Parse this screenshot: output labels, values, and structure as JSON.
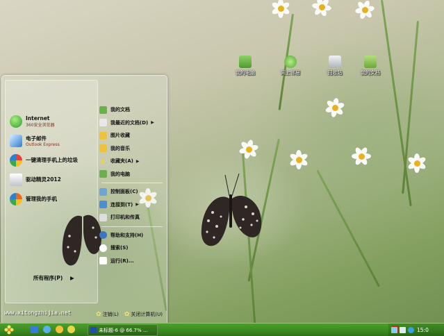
{
  "desktop": {
    "icons": [
      {
        "label": "我的电脑",
        "icon": "computer-icon",
        "color": "#6bb14a"
      },
      {
        "label": "网上邻居",
        "icon": "network-icon",
        "color": "#5cb338"
      },
      {
        "label": "回收站",
        "icon": "recycle-bin-icon",
        "color": "#cfd8dc"
      },
      {
        "label": "我的文档",
        "icon": "documents-folder-icon",
        "color": "#87c24c"
      }
    ],
    "watermark": "www.xitongzhijia.net"
  },
  "start_menu": {
    "pinned": [
      {
        "title": "Internet",
        "subtitle": "360安全浏览器",
        "icon": "browser-360-icon",
        "color": "#3ab54a"
      },
      {
        "title": "电子邮件",
        "subtitle": "Outlook Express",
        "icon": "email-icon",
        "color": "#2f7fd1"
      },
      {
        "title": "一键清理手机上的垃圾",
        "subtitle": "",
        "icon": "phone-clean-icon",
        "color": "#e7423a"
      },
      {
        "title": "驱动精灵2012",
        "subtitle": "",
        "icon": "driver-icon",
        "color": "#eeeeee"
      },
      {
        "title": "管理我的手机",
        "subtitle": "",
        "icon": "phone-manager-icon",
        "color": "#e96a20"
      }
    ],
    "all_programs": "所有程序(P)",
    "right": [
      {
        "label": "我的文档",
        "icon": "folder-icon",
        "color": "#f0c23a",
        "arrow": ""
      },
      {
        "label": "我最近的文档(D)",
        "icon": "recent-docs-icon",
        "color": "#f0c23a",
        "arrow": "▶"
      },
      {
        "label": "图片收藏",
        "icon": "pictures-icon",
        "color": "#f0c23a",
        "arrow": ""
      },
      {
        "label": "我的音乐",
        "icon": "music-icon",
        "color": "#f0c23a",
        "arrow": ""
      },
      {
        "label": "收藏夹(A)",
        "icon": "favorites-star-icon",
        "color": "#f2d43a",
        "arrow": "▶"
      },
      {
        "label": "我的电脑",
        "icon": "computer-icon",
        "color": "#6bb14a",
        "arrow": ""
      },
      {
        "label": "控制面板(C)",
        "icon": "control-panel-icon",
        "color": "#6aa6d8",
        "arrow": ""
      },
      {
        "label": "连接到(T)",
        "icon": "connect-icon",
        "color": "#4a8fd6",
        "arrow": "▶"
      },
      {
        "label": "打印机和传真",
        "icon": "printer-icon",
        "color": "#dddddd",
        "arrow": ""
      },
      {
        "label": "帮助和支持(H)",
        "icon": "help-icon",
        "color": "#3b76c6",
        "arrow": ""
      },
      {
        "label": "搜索(S)",
        "icon": "search-icon",
        "color": "#ffffff",
        "arrow": ""
      },
      {
        "label": "运行(R)...",
        "icon": "run-icon",
        "color": "#ffffff",
        "arrow": ""
      }
    ],
    "logoff": "注销(L)",
    "shutdown": "关闭计算机(U)"
  },
  "taskbar": {
    "start_icon": "windows-flower-icon",
    "quicklaunch": [
      {
        "icon": "show-desktop-icon",
        "color": "#3a7bd5"
      },
      {
        "icon": "browser-icon",
        "color": "#58b0e8"
      },
      {
        "icon": "media-icon",
        "color": "#f0c23a"
      },
      {
        "icon": "sync-icon",
        "color": "#e5d64a"
      }
    ],
    "task": {
      "label": "未标题-6 @ 66.7% ...",
      "icon": "photoshop-icon"
    },
    "ime": "S",
    "tray": [
      {
        "icon": "network-tray-icon",
        "color": "#8ccbf0"
      },
      {
        "icon": "volume-tray-icon",
        "color": "#dfeaf3"
      },
      {
        "icon": "shield-tray-icon",
        "color": "#3aa0e6"
      }
    ],
    "clock": "15:0"
  },
  "colors": {
    "taskbar": "#3c8a20",
    "accent": "#6bb14a",
    "subtitle": "#8a2d12"
  }
}
